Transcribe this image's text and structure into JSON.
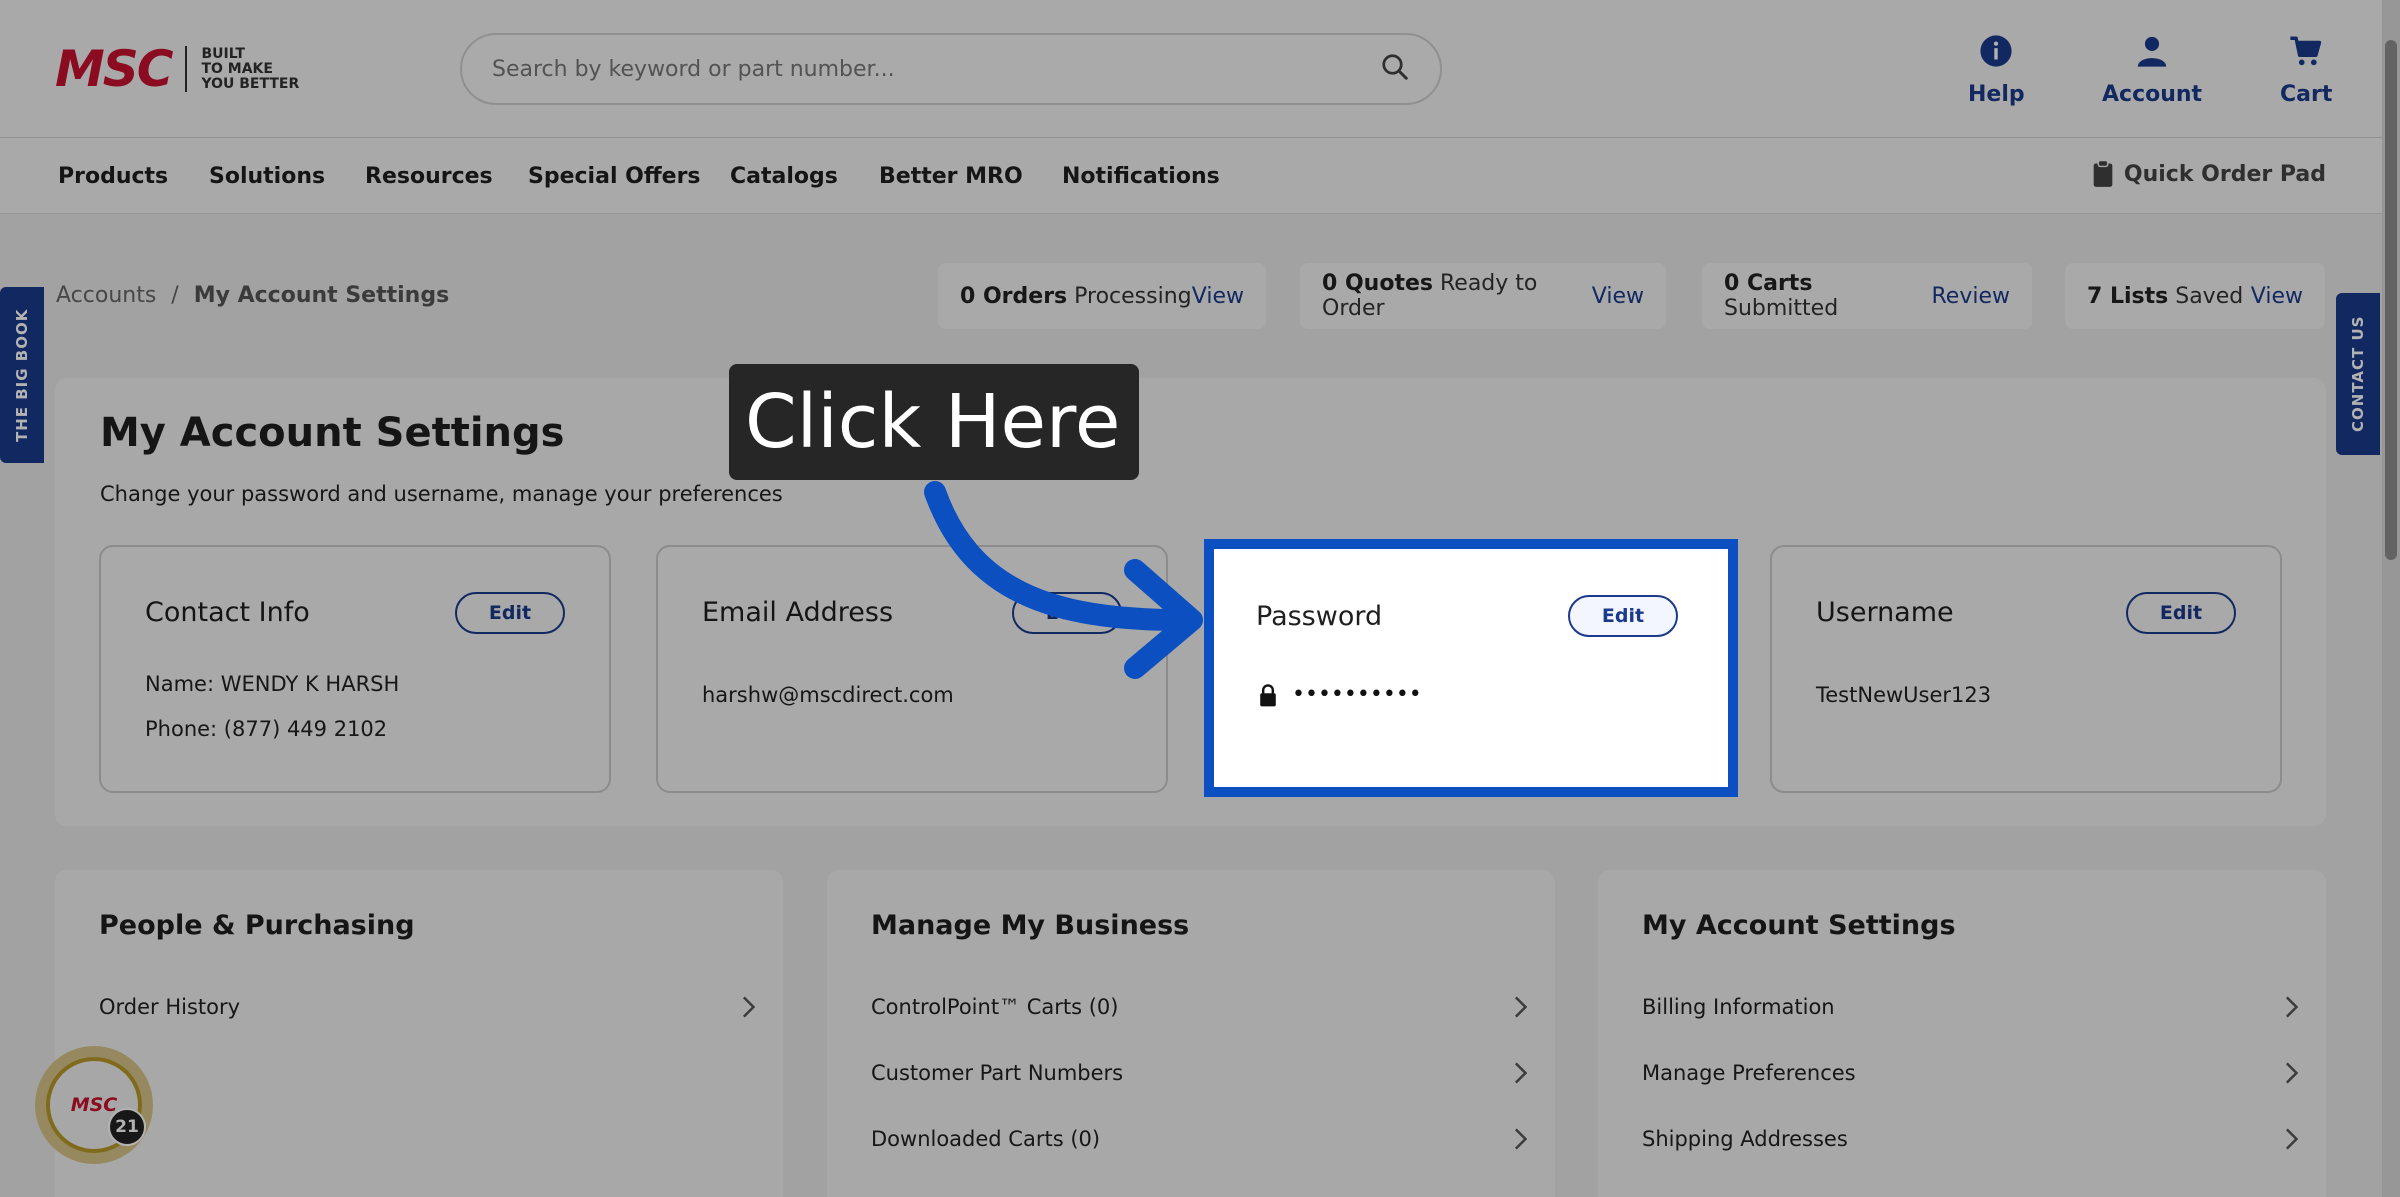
{
  "header": {
    "logo_text": "MSC",
    "logo_tagline": [
      "BUILT",
      "TO MAKE",
      "YOU BETTER"
    ],
    "search_placeholder": "Search by keyword or part number...",
    "help_label": "Help",
    "account_label": "Account",
    "cart_label": "Cart"
  },
  "nav": {
    "items": [
      "Products",
      "Solutions",
      "Resources",
      "Special Offers",
      "Catalogs",
      "Better MRO",
      "Notifications"
    ],
    "quick_order": "Quick Order Pad"
  },
  "side_tabs": {
    "left": "THE BIG BOOK",
    "right": "CONTACT US"
  },
  "breadcrumb": {
    "root": "Accounts",
    "separator": "/",
    "current": "My Account Settings"
  },
  "status": [
    {
      "count": "0 Orders",
      "text": "Processing",
      "link": "View"
    },
    {
      "count": "0 Quotes",
      "text": "Ready to Order",
      "link": "View"
    },
    {
      "count": "0 Carts",
      "text": "Submitted",
      "link": "Review"
    },
    {
      "count": "7 Lists",
      "text": "Saved",
      "link": "View"
    }
  ],
  "settings": {
    "title": "My Account Settings",
    "subtitle": "Change your password and username, manage your preferences",
    "edit_label": "Edit",
    "contact": {
      "title": "Contact Info",
      "name": "Name: WENDY K HARSH",
      "phone": "Phone: (877) 449 2102"
    },
    "email": {
      "title": "Email Address",
      "value": "harshw@mscdirect.com"
    },
    "password": {
      "title": "Password",
      "value": "••••••••••"
    },
    "username": {
      "title": "Username",
      "value": "TestNewUser123"
    }
  },
  "callout": {
    "text": "Click Here"
  },
  "bottom": {
    "people": {
      "title": "People & Purchasing",
      "items": [
        "Order History"
      ]
    },
    "business": {
      "title": "Manage My Business",
      "items": [
        "ControlPoint™ Carts (0)",
        "Customer Part Numbers",
        "Downloaded Carts (0)"
      ]
    },
    "account": {
      "title": "My Account Settings",
      "items": [
        "Billing Information",
        "Manage Preferences",
        "Shipping Addresses"
      ]
    }
  },
  "rewards": {
    "logo": "MSC",
    "count": "21"
  },
  "colors": {
    "brand_red": "#c8102e",
    "brand_blue": "#1b3a8c",
    "highlight_blue": "#0b4fc1"
  }
}
